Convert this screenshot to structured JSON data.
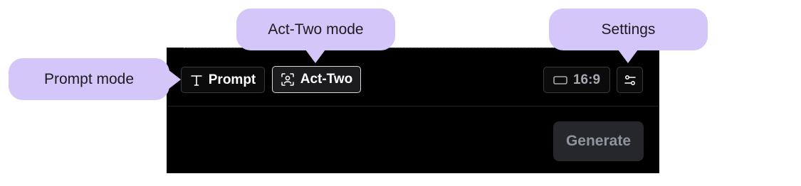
{
  "toolbar": {
    "prompt_label": "Prompt",
    "act_two_label": "Act-Two",
    "aspect_ratio": "16:9",
    "settings_icon": "sliders-icon",
    "prompt_icon": "text-t-icon",
    "act_two_icon": "face-scan-icon",
    "ratio_icon": "rectangle-icon"
  },
  "actions": {
    "generate_label": "Generate"
  },
  "callouts": {
    "prompt_mode": "Prompt mode",
    "act_two_mode": "Act-Two mode",
    "settings": "Settings"
  },
  "colors": {
    "panel_bg": "#000000",
    "callout_bg": "#d4c6f8",
    "generate_bg": "#26272b",
    "generate_text": "#8f949e"
  }
}
